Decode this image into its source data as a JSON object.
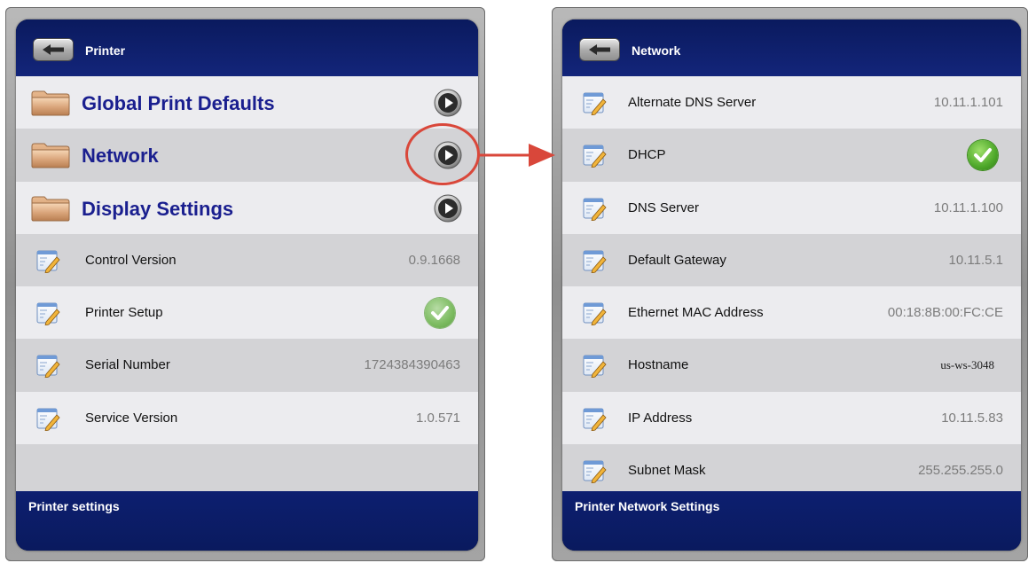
{
  "left_panel": {
    "header": {
      "back_icon": "back-arrow-icon",
      "title": "Printer"
    },
    "folders": [
      {
        "label": "Global Print Defaults",
        "icon": "folder-icon",
        "action_icon": "play-arrow-icon"
      },
      {
        "label": "Network",
        "icon": "folder-icon",
        "action_icon": "play-arrow-icon"
      },
      {
        "label": "Display Settings",
        "icon": "folder-icon",
        "action_icon": "play-arrow-icon"
      }
    ],
    "items": [
      {
        "label": "Control Version",
        "value": "0.9.1668"
      },
      {
        "label": "Printer Setup",
        "value": "checked"
      },
      {
        "label": "Serial Number",
        "value": "1724384390463"
      },
      {
        "label": "Service Version",
        "value": "1.0.571"
      }
    ],
    "footer": "Printer settings"
  },
  "right_panel": {
    "header": {
      "back_icon": "back-arrow-icon",
      "title": "Network"
    },
    "items": [
      {
        "label": "Alternate DNS Server",
        "value": "10.11.1.101"
      },
      {
        "label": "DHCP",
        "value": "checked"
      },
      {
        "label": "DNS Server",
        "value": "10.11.1.100"
      },
      {
        "label": "Default Gateway",
        "value": "10.11.5.1"
      },
      {
        "label": "Ethernet MAC Address",
        "value": "00:18:8B:00:FC:CE"
      },
      {
        "label": "Hostname",
        "value": "us-ws-3048"
      },
      {
        "label": "IP Address",
        "value": "10.11.5.83"
      },
      {
        "label": "Subnet Mask",
        "value": "255.255.255.0"
      }
    ],
    "footer": "Printer Network Settings"
  },
  "colors": {
    "navy": "#0c1f6e",
    "row_light": "#ececef",
    "row_dark": "#d3d3d6",
    "link_blue": "#1a1f8f",
    "annotation_red": "#d9473a",
    "check_green": "#4ea82a"
  }
}
